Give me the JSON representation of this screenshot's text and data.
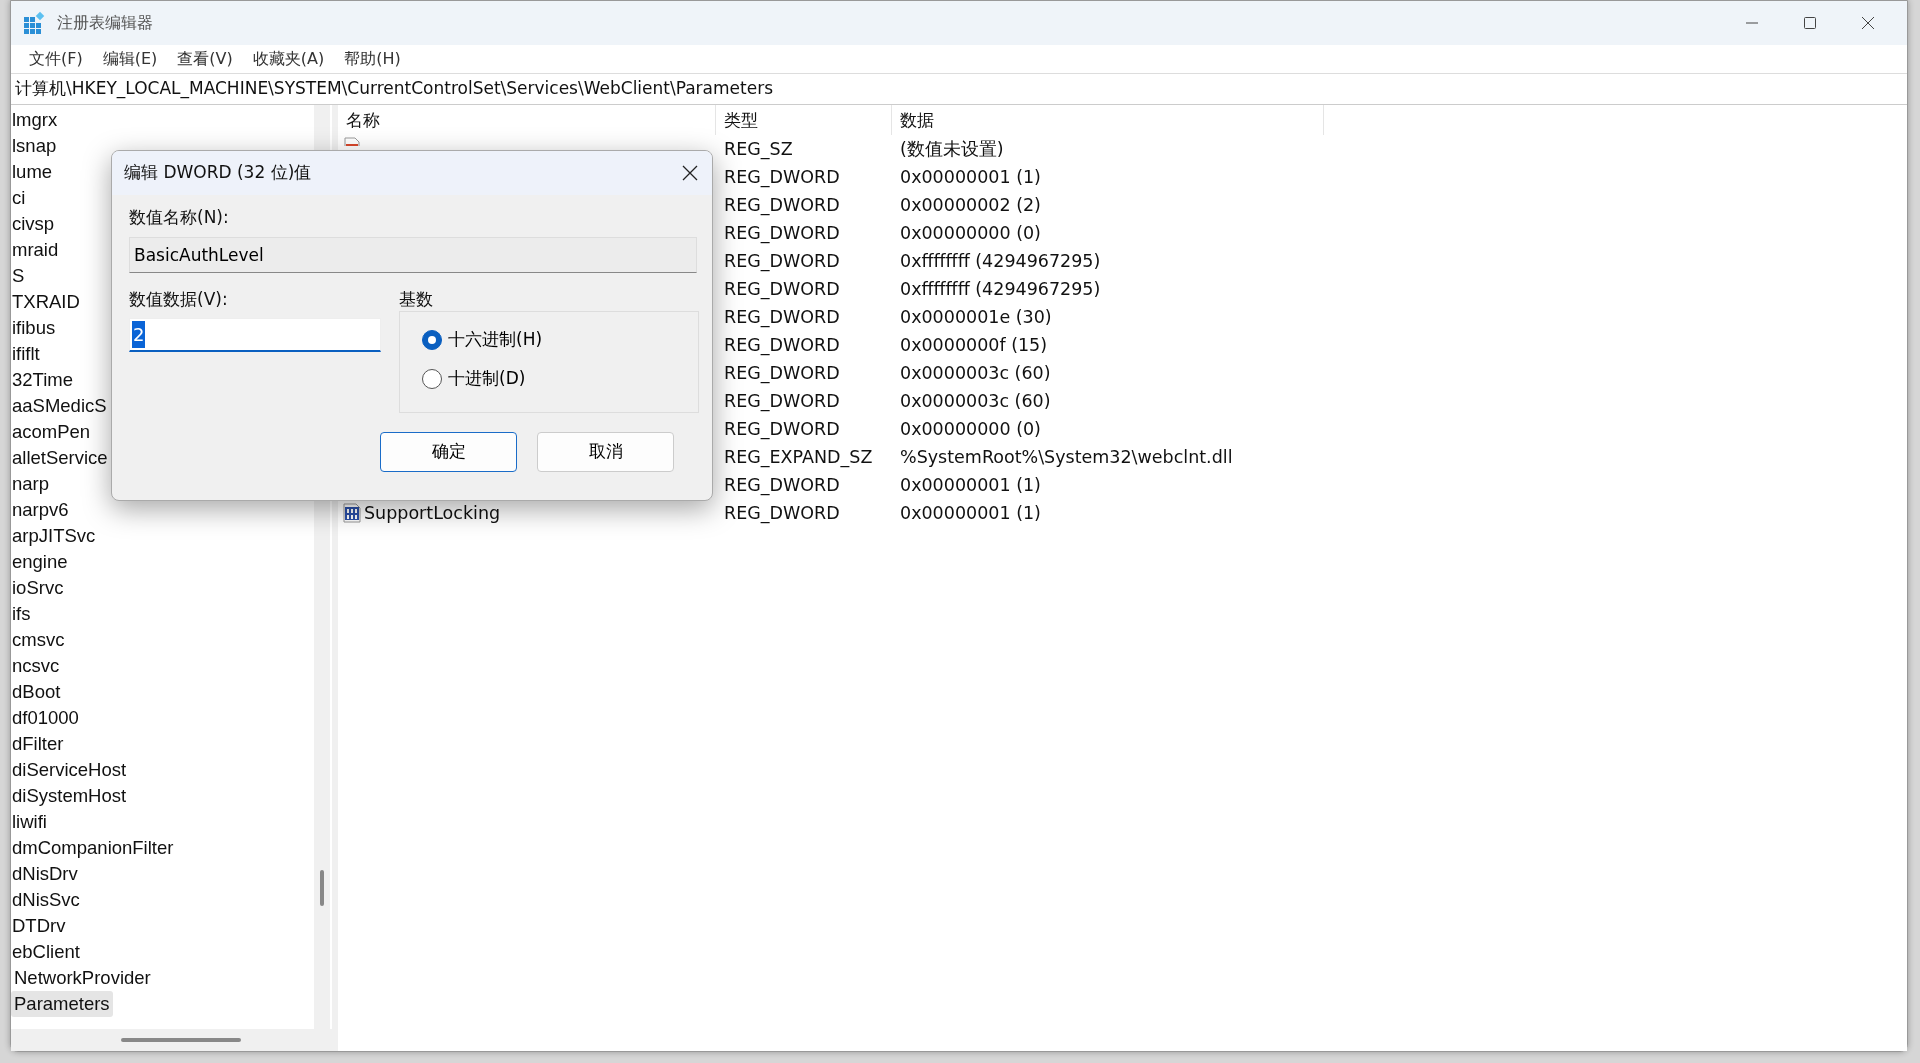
{
  "window": {
    "title": "注册表编辑器"
  },
  "menu": [
    {
      "label": "文件(F)"
    },
    {
      "label": "编辑(E)"
    },
    {
      "label": "查看(V)"
    },
    {
      "label": "收藏夹(A)"
    },
    {
      "label": "帮助(H)"
    }
  ],
  "address": "计算机\\HKEY_LOCAL_MACHINE\\SYSTEM\\CurrentControlSet\\Services\\WebClient\\Parameters",
  "tree": [
    {
      "label": "lmgrx",
      "selected": false
    },
    {
      "label": "lsnap",
      "selected": false
    },
    {
      "label": "lume",
      "selected": false
    },
    {
      "label": "ci",
      "selected": false
    },
    {
      "label": "civsp",
      "selected": false
    },
    {
      "label": "mraid",
      "selected": false
    },
    {
      "label": "S",
      "selected": false
    },
    {
      "label": "TXRAID",
      "selected": false
    },
    {
      "label": "ifibus",
      "selected": false
    },
    {
      "label": "ififlt",
      "selected": false
    },
    {
      "label": "32Time",
      "selected": false
    },
    {
      "label": "aaSMedicS",
      "selected": false
    },
    {
      "label": "acomPen",
      "selected": false
    },
    {
      "label": "alletService",
      "selected": false
    },
    {
      "label": "narp",
      "selected": false
    },
    {
      "label": "narpv6",
      "selected": false
    },
    {
      "label": "arpJITSvc",
      "selected": false
    },
    {
      "label": "engine",
      "selected": false
    },
    {
      "label": "ioSrvc",
      "selected": false
    },
    {
      "label": "ifs",
      "selected": false
    },
    {
      "label": "cmsvc",
      "selected": false
    },
    {
      "label": "ncsvc",
      "selected": false
    },
    {
      "label": "dBoot",
      "selected": false
    },
    {
      "label": "df01000",
      "selected": false
    },
    {
      "label": "dFilter",
      "selected": false
    },
    {
      "label": "diServiceHost",
      "selected": false
    },
    {
      "label": "diSystemHost",
      "selected": false
    },
    {
      "label": "liwifi",
      "selected": false
    },
    {
      "label": "dmCompanionFilter",
      "selected": false
    },
    {
      "label": "dNisDrv",
      "selected": false
    },
    {
      "label": "dNisSvc",
      "selected": false
    },
    {
      "label": "DTDrv",
      "selected": false
    },
    {
      "label": "ebClient",
      "selected": false,
      "children": [
        {
          "label": "NetworkProvider",
          "selected": false
        },
        {
          "label": "Parameters",
          "selected": true
        }
      ]
    }
  ],
  "table": {
    "columns": [
      "名称",
      "类型",
      "数据"
    ],
    "rows": [
      {
        "kind": "string",
        "type": "REG_SZ",
        "data": "(数值未设置)"
      },
      {
        "kind": "dword",
        "type": "REG_DWORD",
        "data": "0x00000001 (1)"
      },
      {
        "kind": "dword",
        "type": "REG_DWORD",
        "data": "0x00000002 (2)"
      },
      {
        "kind": "dword",
        "type": "REG_DWORD",
        "data": "0x00000000 (0)"
      },
      {
        "kind": "dword",
        "type": "REG_DWORD",
        "data": "0xffffffff (4294967295)"
      },
      {
        "kind": "dword",
        "type": "REG_DWORD",
        "data": "0xffffffff (4294967295)"
      },
      {
        "kind": "dword",
        "type": "REG_DWORD",
        "data": "0x0000001e (30)"
      },
      {
        "kind": "dword",
        "type": "REG_DWORD",
        "data": "0x0000000f (15)"
      },
      {
        "kind": "dword",
        "type": "REG_DWORD",
        "data": "0x0000003c (60)"
      },
      {
        "kind": "dword",
        "type": "REG_DWORD",
        "data": "0x0000003c (60)"
      },
      {
        "kind": "dword",
        "type": "REG_DWORD",
        "data": "0x00000000 (0)"
      },
      {
        "kind": "string",
        "type": "REG_EXPAND_SZ",
        "data": "%SystemRoot%\\System32\\webclnt.dll"
      },
      {
        "kind": "dword",
        "type": "REG_DWORD",
        "data": "0x00000001 (1)"
      },
      {
        "name": "SupportLocking",
        "kind": "dword",
        "type": "REG_DWORD",
        "data": "0x00000001 (1)"
      }
    ]
  },
  "dialog": {
    "title": "编辑 DWORD (32 位)值",
    "name_label": "数值名称(N):",
    "name_value": "BasicAuthLevel",
    "data_label": "数值数据(V):",
    "data_value": "2",
    "base_label": "基数",
    "bases": [
      {
        "label": "十六进制(H)",
        "selected": true
      },
      {
        "label": "十进制(D)",
        "selected": false
      }
    ],
    "buttons": [
      {
        "label": "确定",
        "default": true
      },
      {
        "label": "取消",
        "default": false
      }
    ]
  }
}
